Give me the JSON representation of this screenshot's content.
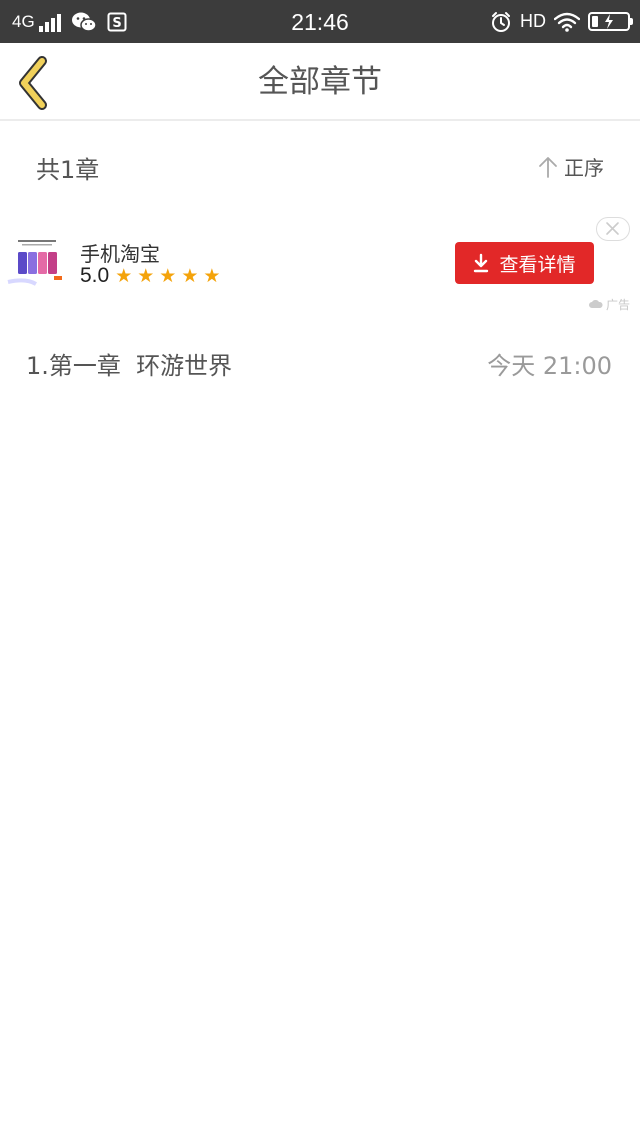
{
  "status_bar": {
    "network": "4G",
    "time": "21:46",
    "hd": "HD",
    "signal_bars": 4,
    "battery_level": 0.15
  },
  "header": {
    "title": "全部章节",
    "back_icon": "chevron-left-icon",
    "accent_color": "#f1d15a"
  },
  "list_header": {
    "count_label": "共1章",
    "sort_label": "正序",
    "sort_icon": "arrow-up-icon"
  },
  "ad": {
    "app_name": "手机淘宝",
    "rating": "5.0",
    "stars": 5,
    "cta_label": "查看详情",
    "cta_icon": "download-icon",
    "close_icon": "close-icon",
    "ad_label": "广告",
    "cta_color": "#e22828",
    "star_color": "#f4a30b"
  },
  "chapters": [
    {
      "title": "1.第一章  环游世界",
      "date": "今天 21:00"
    }
  ]
}
